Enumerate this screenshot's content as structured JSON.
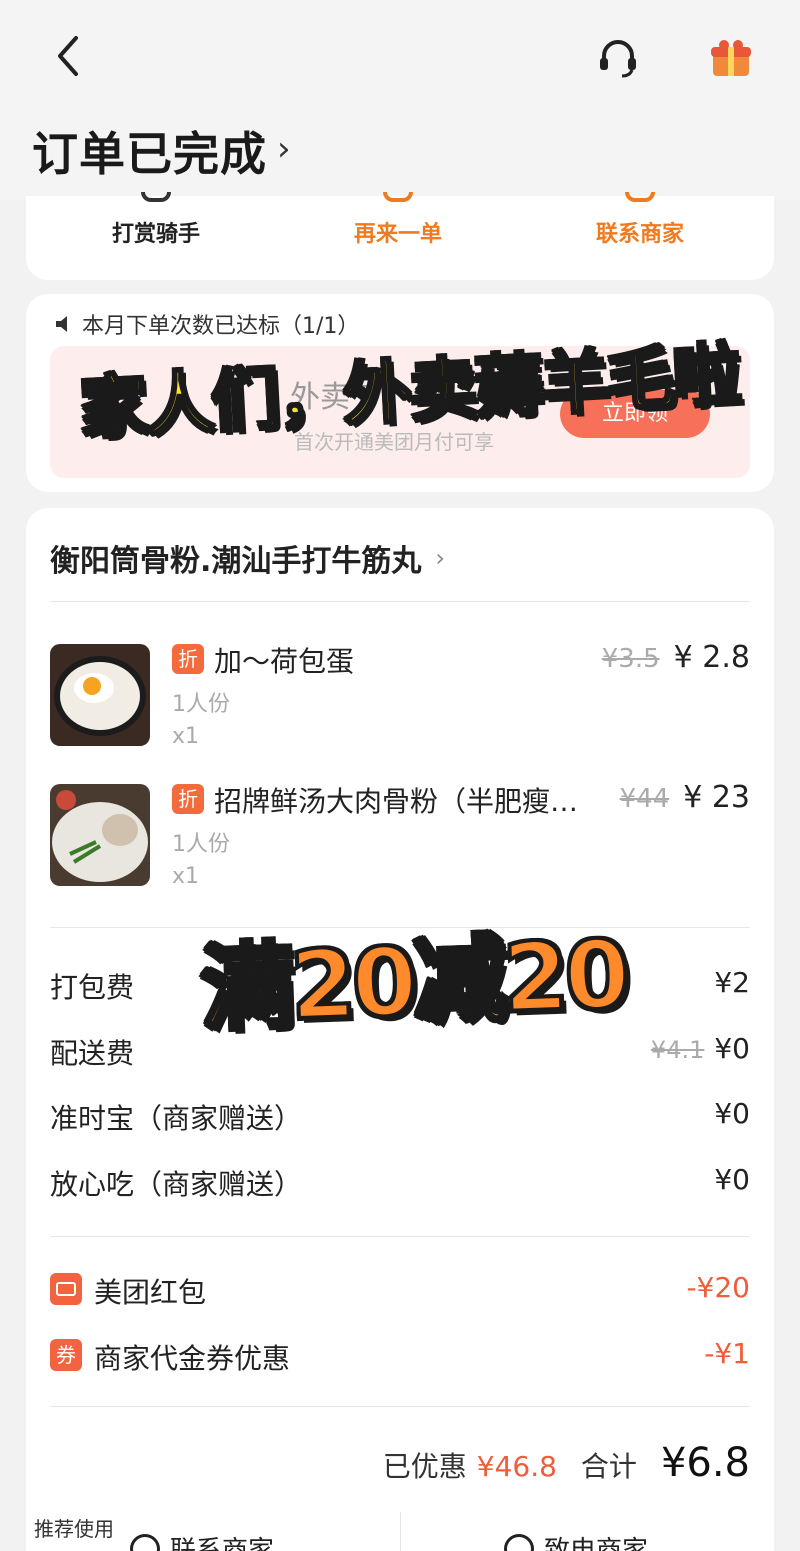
{
  "header": {
    "status_title": "订单已完成",
    "status_chevron": "›"
  },
  "actions": [
    {
      "label": "打赏骑手"
    },
    {
      "label": "再来一单"
    },
    {
      "label": "联系商家"
    }
  ],
  "promo": {
    "notice": "本月下单次数已达标（1/1）",
    "banner_title": "外卖节",
    "banner_sub": "首次开通美团月付可享",
    "banner_button": "立即领",
    "overlay_text": "家人们，外卖薅羊毛啦"
  },
  "store": {
    "name": "衡阳筒骨粉.潮汕手打牛筋丸",
    "chevron": "›"
  },
  "items": [
    {
      "badge": "折",
      "name": "加～荷包蛋",
      "portion": "1人份",
      "qty": "x1",
      "orig_price": "¥3.5",
      "price": "¥ 2.8"
    },
    {
      "badge": "折",
      "name": "招牌鲜汤大肉骨粉（半肥瘦…",
      "portion": "1人份",
      "qty": "x1",
      "orig_price": "¥44",
      "price": "¥ 23"
    }
  ],
  "overlay_deal": "满20减20",
  "fees": [
    {
      "label": "打包费",
      "orig": "",
      "value": "¥2"
    },
    {
      "label": "配送费",
      "orig": "¥4.1",
      "value": "¥0"
    },
    {
      "label": "准时宝（商家赠送）",
      "orig": "",
      "value": "¥0"
    },
    {
      "label": "放心吃（商家赠送）",
      "orig": "",
      "value": "¥0"
    }
  ],
  "discounts": [
    {
      "icon": "red-envelope-icon",
      "icon_text": "",
      "label": "美团红包",
      "value": "-¥20"
    },
    {
      "icon": "coupon-icon",
      "icon_text": "券",
      "label": "商家代金券优惠",
      "value": "-¥1"
    }
  ],
  "total": {
    "saved_label": "已优惠",
    "saved_value": "¥46.8",
    "sum_label": "合计",
    "sum_value": "¥6.8"
  },
  "bottom": {
    "recommend_label": "推荐使用",
    "left_button": "联系商家",
    "right_button": "致电商家"
  },
  "colors": {
    "accent": "#f07a1e",
    "discount": "#ef5d3a",
    "badge": "#f36a3d"
  }
}
